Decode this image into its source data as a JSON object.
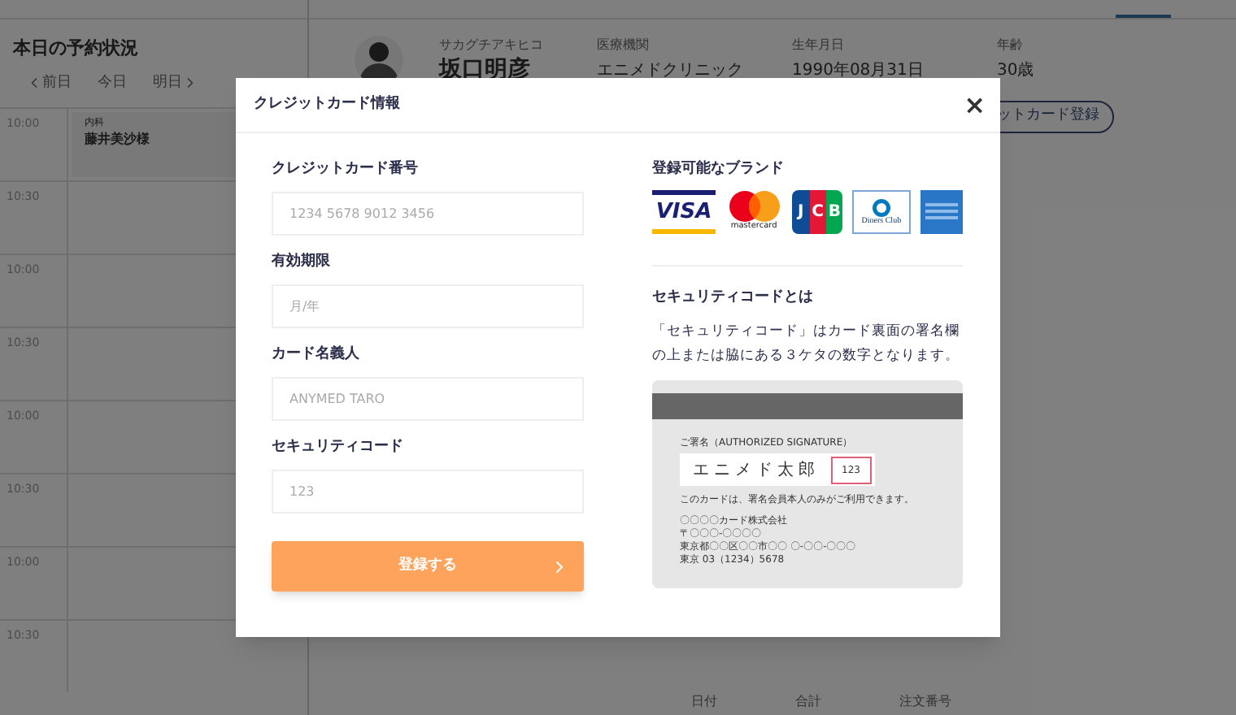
{
  "schedule": {
    "title": "本日の予約状況",
    "nav": [
      {
        "label": "前日",
        "kind": "prev"
      },
      {
        "label": "今日",
        "kind": "today"
      },
      {
        "label": "明日",
        "kind": "next"
      }
    ],
    "times": [
      "10:00",
      "10:30",
      "10:00",
      "10:30",
      "10:00",
      "10:30",
      "10:00",
      "10:30"
    ],
    "appointment": {
      "department": "内科",
      "patient": "藤井美沙様"
    }
  },
  "patient": {
    "fields": [
      {
        "label": "サカグチアキヒコ",
        "value": "坂口明彦"
      },
      {
        "label": "医療機関",
        "value": "エニメドクリニック"
      },
      {
        "label": "生年月日",
        "value": "1990年08月31日"
      },
      {
        "label": "年齢",
        "value": "30歳"
      }
    ],
    "register_button": "ットカード登録",
    "table_columns": [
      "日付",
      "合計",
      "注文番号"
    ]
  },
  "modal": {
    "title": "クレジットカード情報",
    "close": "×",
    "fields": [
      {
        "label": "クレジットカード番号",
        "placeholder": "1234 5678 9012 3456"
      },
      {
        "label": "有効期限",
        "placeholder": "月/年"
      },
      {
        "label": "カード名義人",
        "placeholder": "ANYMED TARO"
      },
      {
        "label": "セキュリティコード",
        "placeholder": "123"
      }
    ],
    "submit": "登録する",
    "brands_title": "登録可能なブランド",
    "brands": [
      {
        "kind": "visa",
        "text": "VISA"
      },
      {
        "kind": "mastercard",
        "text": "mastercard"
      },
      {
        "kind": "jcb",
        "letters": [
          "J",
          "C",
          "B"
        ]
      },
      {
        "kind": "diners",
        "text": "Diners Club"
      },
      {
        "kind": "amex"
      }
    ],
    "security_title": "セキュリティコードとは",
    "security_text": "「セキュリティコード」はカード裏面の署名欄の上または脇にある３ケタの数字となります。",
    "card": {
      "signature_label": "ご署名（AUTHORIZED SIGNATURE）",
      "signature": "エニメド太郎",
      "code": "123",
      "notice": "このカードは、署名会員本人のみがご利用できます。",
      "issuer_lines": [
        "〇〇〇〇カード株式会社",
        "〒〇〇〇-〇〇〇〇",
        "東京都〇〇区〇〇市〇〇 〇-〇〇-〇〇〇",
        "東京 03（1234）5678"
      ]
    }
  }
}
